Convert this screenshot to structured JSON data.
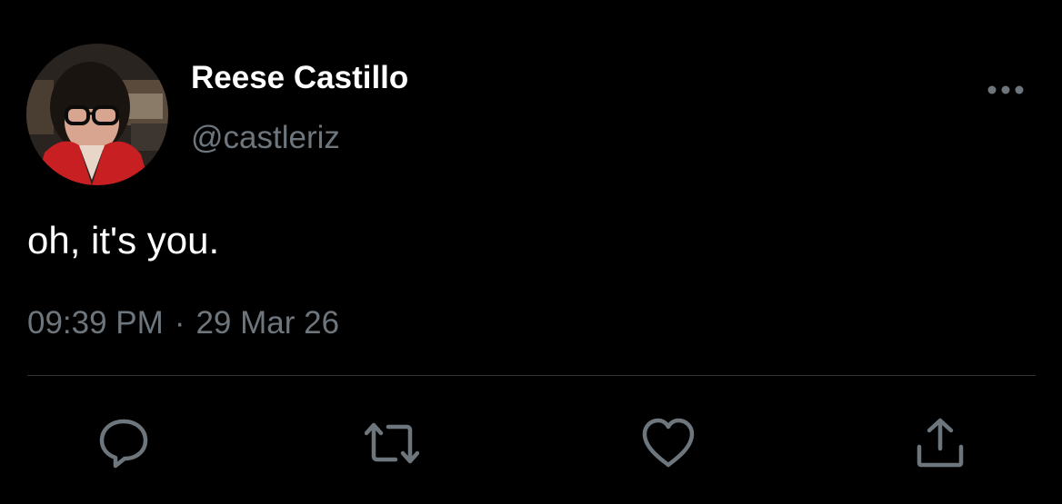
{
  "author": {
    "display_name": "Reese Castillo",
    "handle": "@castleriz",
    "avatar_icon": "profile-photo-avatar"
  },
  "tweet": {
    "text": "oh, it's you.",
    "time": "09:39 PM",
    "separator": "·",
    "date": "29 Mar 26"
  },
  "actions": [
    {
      "name": "reply",
      "icon": "speech-bubble-icon"
    },
    {
      "name": "retweet",
      "icon": "retweet-arrows-icon"
    },
    {
      "name": "like",
      "icon": "heart-icon"
    },
    {
      "name": "share",
      "icon": "share-upload-icon"
    }
  ],
  "colors": {
    "background": "#000000",
    "primary_text": "#ffffff",
    "secondary_text": "#6e767d",
    "divider": "#2f3336",
    "icon": "#6e767d"
  }
}
